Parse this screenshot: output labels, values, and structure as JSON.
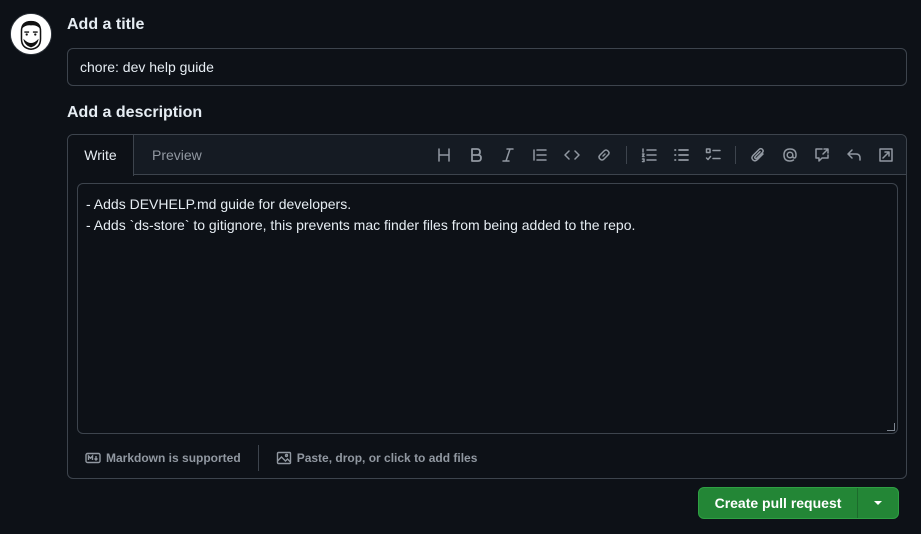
{
  "title_section": {
    "label": "Add a title",
    "value": "chore: dev help guide"
  },
  "description_section": {
    "label": "Add a description",
    "tabs": [
      {
        "label": "Write",
        "active": true
      },
      {
        "label": "Preview",
        "active": false
      }
    ],
    "toolbar": [
      "heading-icon",
      "bold-icon",
      "italic-icon",
      "quote-icon",
      "code-icon",
      "link-icon",
      "ordered-list-icon",
      "unordered-list-icon",
      "task-list-icon",
      "attach-icon",
      "mention-icon",
      "cross-reference-icon",
      "reply-icon",
      "fullscreen-icon"
    ],
    "body_lines": [
      "- Adds DEVHELP.md guide for developers.",
      "- Adds `ds-store` to gitignore, this prevents mac finder files from being added to the repo."
    ],
    "footer": {
      "markdown_label": "Markdown is supported",
      "files_label": "Paste, drop, or click to add files"
    }
  },
  "actions": {
    "create_label": "Create pull request"
  },
  "colors": {
    "background": "#0d1117",
    "border": "#3d444d",
    "primary_button": "#238636",
    "muted_text": "#9198a1"
  }
}
